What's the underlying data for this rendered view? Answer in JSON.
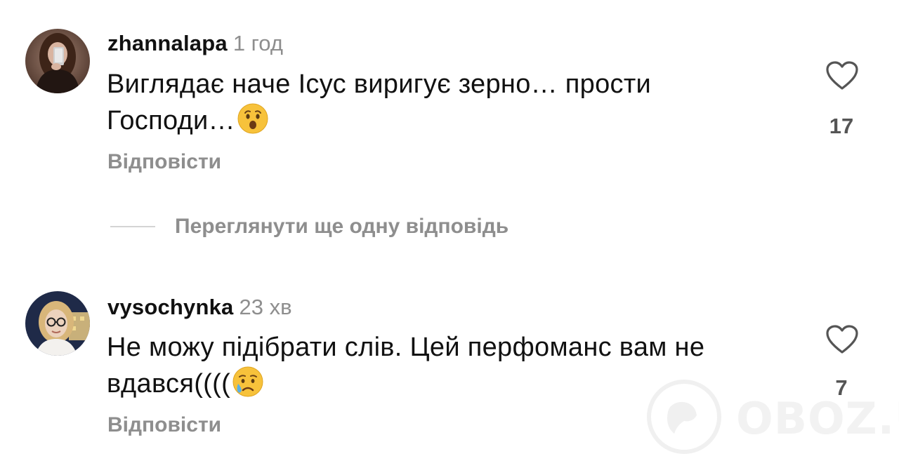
{
  "comments": [
    {
      "username": "zhannalapa",
      "time": "1 год",
      "text": "Виглядає наче Ісус виригує зерно… прости Господи…",
      "emoji": "astonished-face-emoji",
      "reply_label": "Відповісти",
      "likes": "17",
      "like_icon": "heart-outline-icon"
    },
    {
      "username": "vysochynka",
      "time": "23 хв",
      "text": "Не можу підібрати слів. Цей перфоманс вам не вдався((((",
      "emoji": "crying-face-emoji",
      "reply_label": "Відповісти",
      "likes": "7",
      "like_icon": "heart-outline-icon"
    }
  ],
  "view_more_replies": "Переглянути ще одну відповідь",
  "watermark": {
    "text": "OBOZ.UA",
    "icon": "globe-logo-icon"
  },
  "colors": {
    "text": "#111111",
    "muted": "#8e8e8e",
    "like_count": "#555555",
    "divider": "#d4d4d4"
  }
}
